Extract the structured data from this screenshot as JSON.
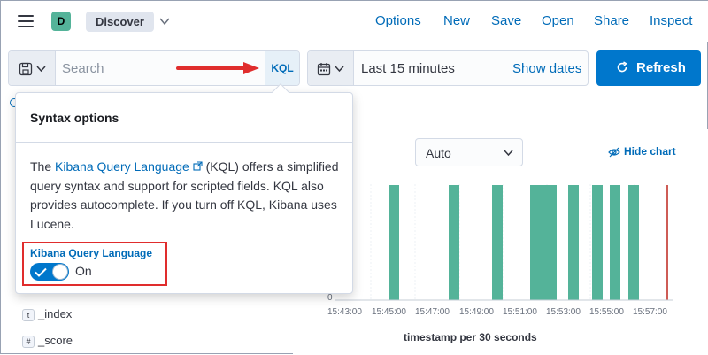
{
  "space": {
    "initial": "D"
  },
  "breadcrumb": {
    "label": "Discover"
  },
  "topnav": [
    "Options",
    "New",
    "Save",
    "Open",
    "Share",
    "Inspect"
  ],
  "query": {
    "placeholder": "Search",
    "language_button": "KQL"
  },
  "time": {
    "range": "Last 15 minutes",
    "show_dates": "Show dates"
  },
  "refresh": {
    "label": "Refresh"
  },
  "chart": {
    "interval": "Auto",
    "hide_chart": "Hide chart",
    "x_title": "timestamp per 30 seconds",
    "x_ticks": [
      "15:43:00",
      "15:45:00",
      "15:47:00",
      "15:49:00",
      "15:51:00",
      "15:53:00",
      "15:55:00",
      "15:57:00"
    ],
    "zero_label": "0",
    "bar_color": "#54b399"
  },
  "fields": [
    {
      "type": "t",
      "name": "_index"
    },
    {
      "type": "#",
      "name": "_score"
    }
  ],
  "popover": {
    "title": "Syntax options",
    "text_before": "The ",
    "link": "Kibana Query Language",
    "text_after": " (KQL) offers a simplified query syntax and support for scripted fields. KQL also provides autocomplete. If you turn off KQL, Kibana uses Lucene.",
    "switch_label": "Kibana Query Language",
    "switch_state": "On"
  },
  "colors": {
    "accent": "#0077cc",
    "link": "#006bb8",
    "annotation": "#e02d2d"
  }
}
